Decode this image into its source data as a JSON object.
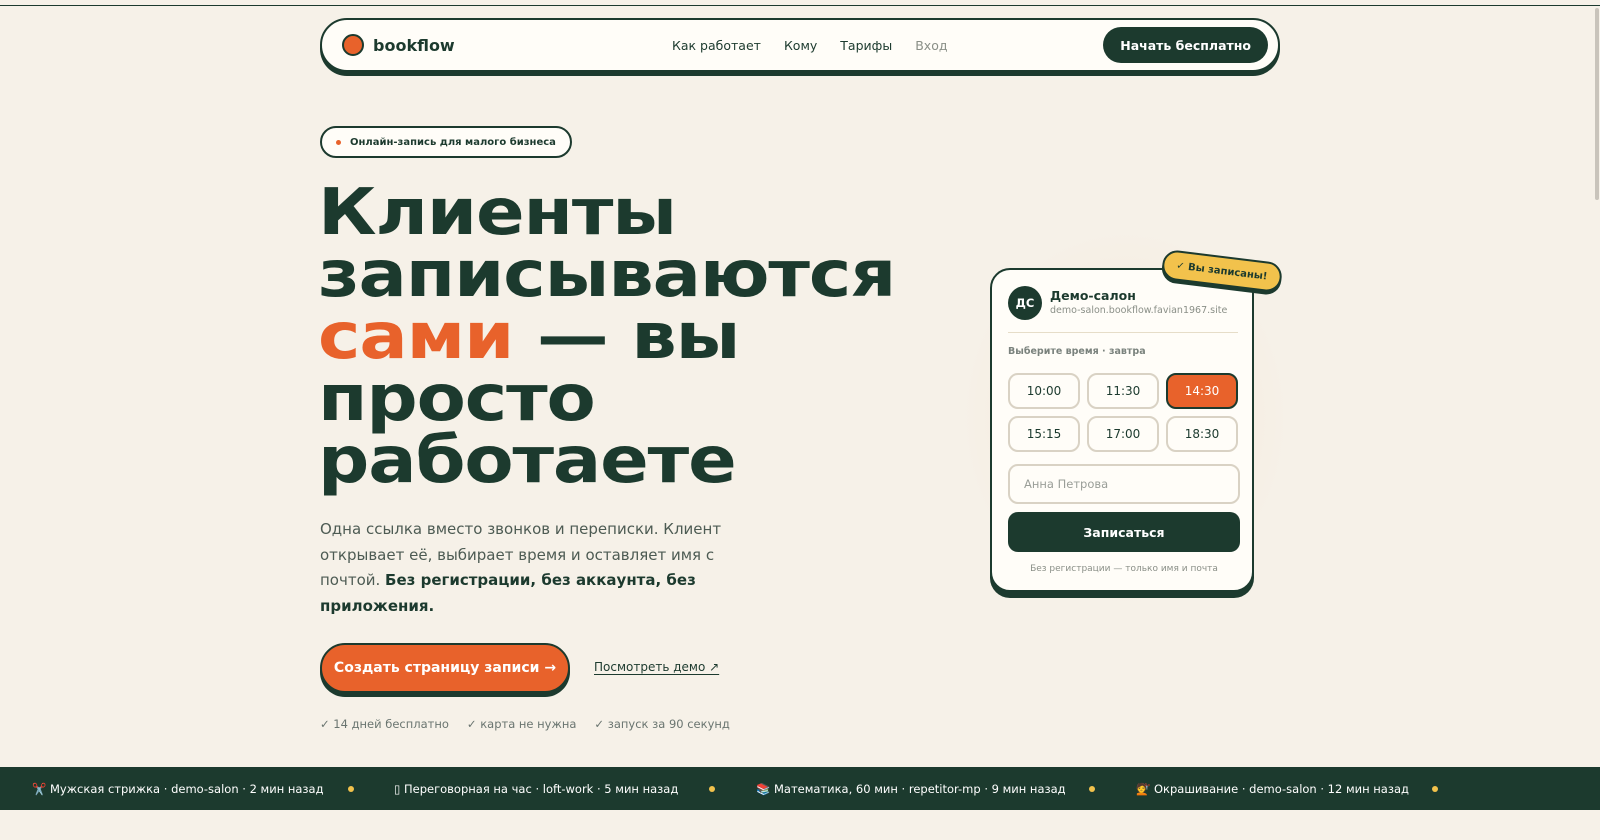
{
  "nav": {
    "logo": "bookflow",
    "links": [
      "Как работает",
      "Кому",
      "Тарифы",
      "Вход"
    ],
    "cta": "Начать бесплатно"
  },
  "badge": "Онлайн-запись для малого бизнеса",
  "hero": {
    "line1": "Клиенты",
    "line2": "записываются",
    "line3_accent": "сами",
    "line3_rest": " — вы",
    "line4": "просто",
    "line5": "работаете",
    "sub_plain": "Одна ссылка вместо звонков и переписки. Клиент открывает её, выбирает время и оставляет имя с почтой. ",
    "sub_bold": "Без регистрации, без аккаунта, без приложения.",
    "primary_cta": "Создать страницу записи →",
    "demo_link": "Посмотреть демо ↗",
    "perks": [
      "✓ 14 дней бесплатно",
      "✓ карта не нужна",
      "✓ запуск за 90 секунд"
    ]
  },
  "card": {
    "avatar": "ДС",
    "name": "Демо-салон",
    "url": "demo-salon.bookflow.favian1967.site",
    "label": "Выберите время · завтра",
    "slots": [
      "10:00",
      "11:30",
      "14:30",
      "15:15",
      "17:00",
      "18:30"
    ],
    "active_slot": "14:30",
    "input_placeholder": "Анна Петрова",
    "submit": "Записаться",
    "note": "Без регистрации — только имя и почта",
    "sticker": "✓ Вы записаны!"
  },
  "ticker": [
    "✂️ Мужская стрижка · demo-salon · 2 мин назад",
    "▯ Переговорная на час · loft-work · 5 мин назад",
    "📚 Математика, 60 мин · repetitor-mp · 9 мин назад",
    "💇 Окрашивание · demo-salon · 12 мин назад"
  ],
  "colors": {
    "background": "#f6f1e8",
    "primary_dark": "#1c3a2e",
    "accent_orange": "#e8622b",
    "accent_yellow": "#f2c24c"
  }
}
